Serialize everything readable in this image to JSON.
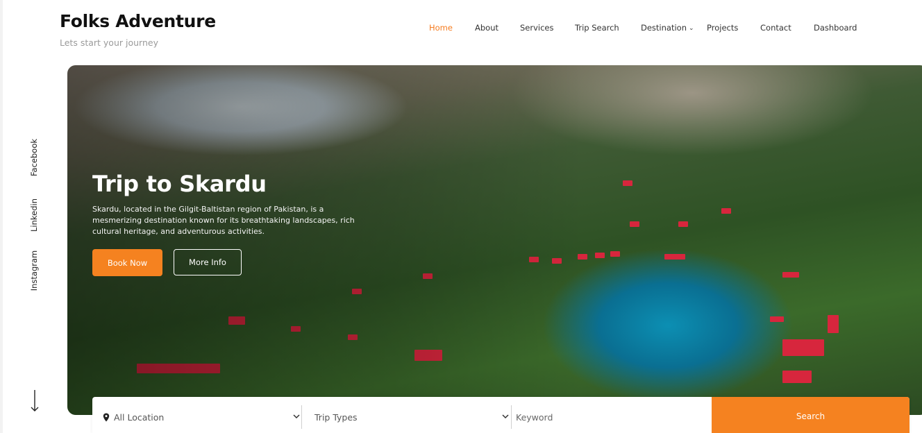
{
  "brand": {
    "title": "Folks Adventure",
    "tagline": "Lets start your journey"
  },
  "nav": {
    "items": [
      {
        "label": "Home",
        "active": true
      },
      {
        "label": "About"
      },
      {
        "label": "Services"
      },
      {
        "label": "Trip Search"
      },
      {
        "label": "Destination",
        "has_dropdown": true
      },
      {
        "label": "Projects"
      },
      {
        "label": "Contact"
      },
      {
        "label": "Dashboard"
      }
    ]
  },
  "social": {
    "items": [
      "Facebook",
      "Linkedin",
      "Instagram"
    ],
    "scroll_icon": "arrow-down-icon"
  },
  "hero": {
    "title": "Trip to Skardu",
    "description": "Skardu, located in the Gilgit-Baltistan region of Pakistan, is a mesmerizing destination known for its breathtaking landscapes, rich cultural heritage, and adventurous activities.",
    "book_label": "Book Now",
    "more_label": "More Info"
  },
  "search": {
    "location_label": "All Location",
    "location_icon": "map-pin-icon",
    "trip_types_label": "Trip Types",
    "keyword_placeholder": "Keyword",
    "keyword_value": "",
    "button_label": "Search"
  },
  "colors": {
    "accent": "#f58220",
    "nav_active": "#f57c20",
    "text_dark": "#111111",
    "tagline": "#9a9a9a"
  }
}
